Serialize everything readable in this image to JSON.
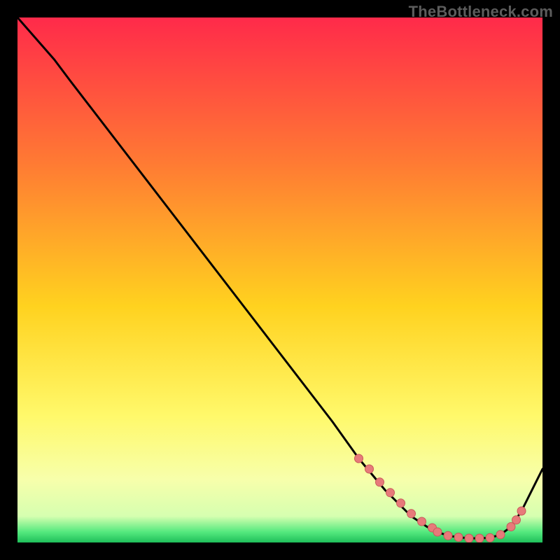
{
  "attribution": "TheBottleneck.com",
  "colors": {
    "bg": "#000000",
    "grad_top": "#ff2a4a",
    "grad_mid_upper": "#ff8a2e",
    "grad_mid": "#ffd700",
    "grad_mid_lower": "#fff96b",
    "grad_green": "#2bd96a",
    "curve": "#000000",
    "marker_fill": "#e77a7a",
    "marker_stroke": "#c85a5a"
  },
  "chart_data": {
    "type": "line",
    "title": "",
    "xlabel": "",
    "ylabel": "",
    "xlim": [
      0,
      100
    ],
    "ylim": [
      0,
      100
    ],
    "series": [
      {
        "name": "bottleneck-curve",
        "x": [
          0,
          7,
          10,
          20,
          30,
          40,
          50,
          60,
          65,
          70,
          75,
          78,
          80,
          82,
          84,
          86,
          88,
          90,
          92,
          94,
          96,
          100
        ],
        "y": [
          100,
          92,
          88,
          75,
          62,
          49,
          36,
          23,
          16,
          10,
          5,
          3,
          2,
          1.3,
          1,
          0.8,
          0.8,
          0.9,
          1.5,
          3,
          6,
          14
        ]
      }
    ],
    "markers": {
      "name": "highlight-segment",
      "x": [
        65,
        67,
        69,
        71,
        73,
        75,
        77,
        79,
        80,
        82,
        84,
        86,
        88,
        90,
        92,
        94,
        95,
        96
      ],
      "y": [
        16,
        14,
        11.5,
        9.5,
        7.5,
        5.5,
        4,
        2.8,
        2,
        1.3,
        1,
        0.8,
        0.8,
        0.9,
        1.5,
        3,
        4.3,
        6
      ]
    }
  }
}
